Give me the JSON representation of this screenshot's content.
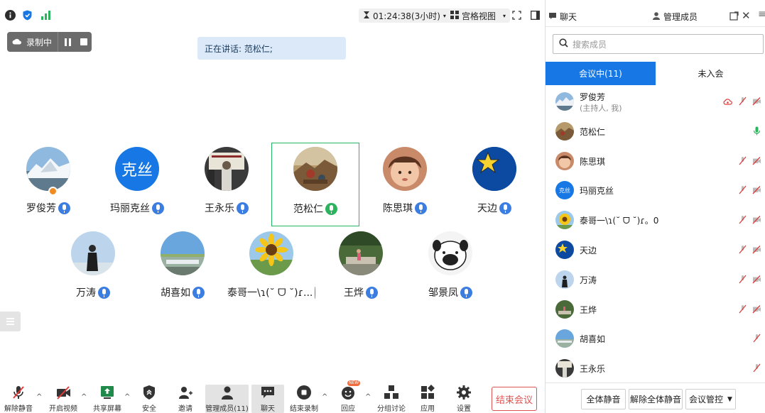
{
  "topbar": {
    "timer": "01:24:38(3小时)",
    "view_label": "宫格视图"
  },
  "recording": {
    "label": "录制中"
  },
  "speaking": {
    "text": "正在讲话: 范松仁;"
  },
  "participants": [
    {
      "name": "罗俊芳",
      "avatar": "mountain",
      "host": true
    },
    {
      "name": "玛丽克丝",
      "avatar": "text",
      "avatar_text": "克丝"
    },
    {
      "name": "王永乐",
      "avatar": "person-bw"
    },
    {
      "name": "范松仁",
      "avatar": "painting",
      "speaking": true
    },
    {
      "name": "陈思琪",
      "avatar": "child"
    },
    {
      "name": "天边",
      "avatar": "star"
    },
    {
      "name": "万涛",
      "avatar": "person-sky"
    },
    {
      "name": "胡喜如",
      "avatar": "landscape"
    },
    {
      "name": "泰哥一\\ɿ(˘ ᗜ ˘)ɾ...",
      "avatar": "sunflower"
    },
    {
      "name": "王烨",
      "avatar": "garden"
    },
    {
      "name": "邹景凤",
      "avatar": "dog"
    }
  ],
  "toolbar": {
    "unmute": "解除静音",
    "video": "开启视频",
    "share": "共享屏幕",
    "security": "安全",
    "invite": "邀请",
    "members": "管理成员(11)",
    "chat": "聊天",
    "stop_record": "结束录制",
    "reaction": "回应",
    "new_badge": "NEW",
    "breakout": "分组讨论",
    "apps": "应用",
    "settings": "设置",
    "end_meeting": "结束会议"
  },
  "panel": {
    "chat_tab": "聊天",
    "members_tab": "管理成员",
    "search_placeholder": "搜索成员",
    "seg_in": "会议中(11)",
    "seg_out": "未入会",
    "members": [
      {
        "name": "罗俊芳",
        "sub": "(主持人, 我)",
        "avatar": "mountain"
      },
      {
        "name": "范松仁",
        "avatar": "painting"
      },
      {
        "name": "陈思琪",
        "avatar": "child"
      },
      {
        "name": "玛丽克丝",
        "avatar": "text",
        "avatar_text": "克丝"
      },
      {
        "name": "泰哥一\\ɿ(˘ ᗜ ˘)ɾ。0",
        "avatar": "sunflower"
      },
      {
        "name": "天边",
        "avatar": "star"
      },
      {
        "name": "万涛",
        "avatar": "person-sky"
      },
      {
        "name": "王烨",
        "avatar": "garden"
      },
      {
        "name": "胡喜如",
        "avatar": "landscape"
      },
      {
        "name": "王永乐",
        "avatar": "person-bw"
      }
    ],
    "mute_all": "全体静音",
    "unmute_all": "解除全体静音",
    "meeting_control": "会议管控"
  },
  "colors": {
    "accent": "#1677e5",
    "speaking_border": "#25b864",
    "end_red": "#e05353"
  }
}
